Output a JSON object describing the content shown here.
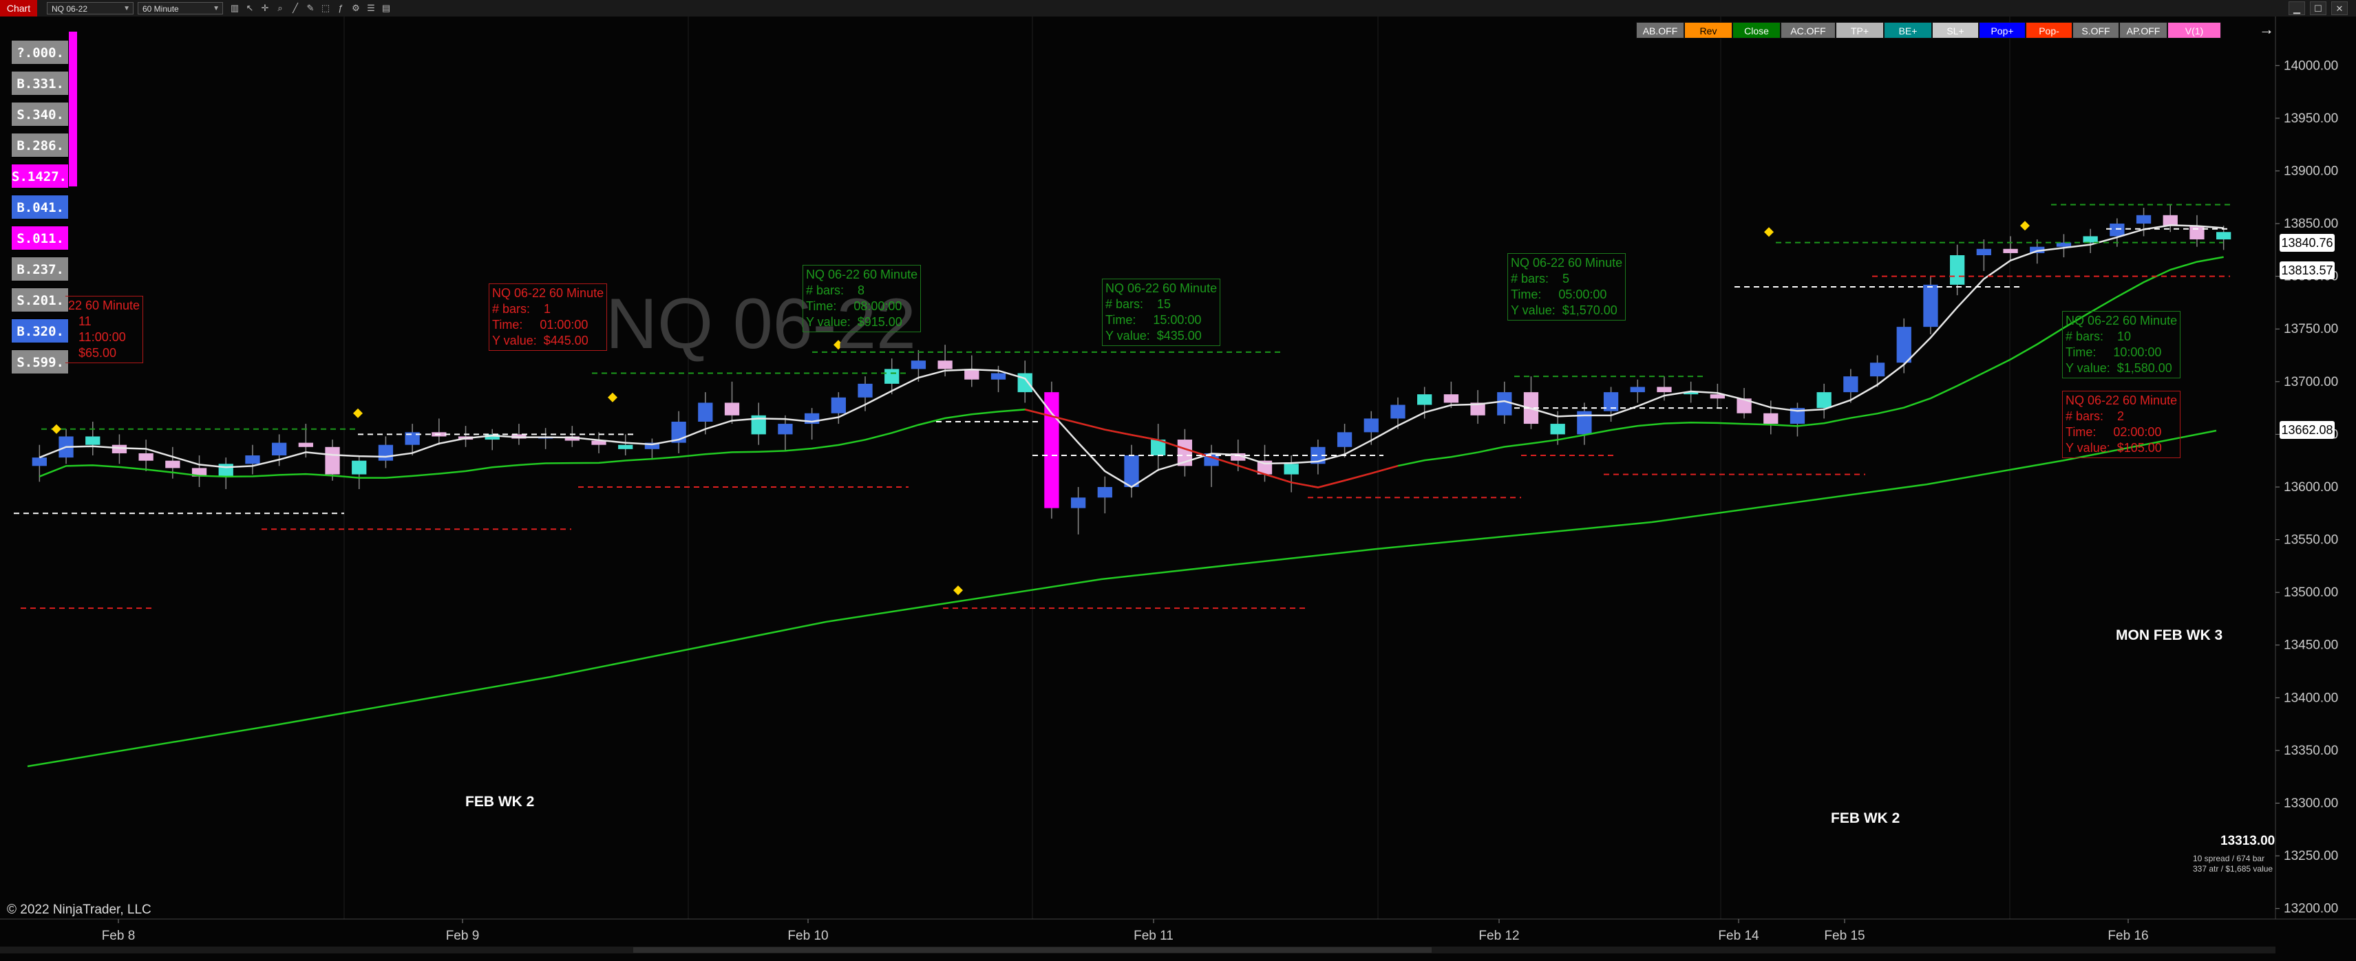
{
  "toolbar": {
    "chart_tab": "Chart",
    "instrument": "NQ 06-22",
    "interval": "60 Minute",
    "icons": [
      "bars-icon",
      "cursor-icon",
      "crosshair-icon",
      "zoom-icon",
      "line-tool-icon",
      "draw-tool-icon",
      "select-icon",
      "indicators-icon",
      "strategy-icon",
      "properties-icon",
      "data-box-icon"
    ],
    "window_buttons": [
      "minimize-icon",
      "maximize-icon",
      "close-icon"
    ]
  },
  "strategy_buttons": [
    {
      "label": "AB.OFF",
      "bg": "#6e6e6e",
      "fg": "#ffffff"
    },
    {
      "label": "Rev",
      "bg": "#ff8c00",
      "fg": "#000000"
    },
    {
      "label": "Close",
      "bg": "#007a00",
      "fg": "#ffffff"
    },
    {
      "label": "AC.OFF",
      "bg": "#6e6e6e",
      "fg": "#ffffff"
    },
    {
      "label": "TP+",
      "bg": "#b4b4b4",
      "fg": "#ffffff"
    },
    {
      "label": "BE+",
      "bg": "#008b8b",
      "fg": "#ffffff"
    },
    {
      "label": "SL+",
      "bg": "#c8c8c8",
      "fg": "#ffffff"
    },
    {
      "label": "Pop+",
      "bg": "#0000ff",
      "fg": "#ffffff"
    },
    {
      "label": "Pop-",
      "bg": "#ff3300",
      "fg": "#ffffff"
    },
    {
      "label": "S.OFF",
      "bg": "#6e6e6e",
      "fg": "#ffffff"
    },
    {
      "label": "AP.OFF",
      "bg": "#6e6e6e",
      "fg": "#ffffff"
    },
    {
      "label": "V(1)",
      "bg": "#ff66cc",
      "fg": "#ffffff"
    }
  ],
  "arrow_icon": "→",
  "side_buttons": [
    {
      "label": "?.000.",
      "bg": "#8a8a8a"
    },
    {
      "label": "B.331.",
      "bg": "#8a8a8a"
    },
    {
      "label": "S.340.",
      "bg": "#8a8a8a"
    },
    {
      "label": "B.286.",
      "bg": "#8a8a8a"
    },
    {
      "label": "S.1427.",
      "bg": "#ff00ff"
    },
    {
      "label": "B.041.",
      "bg": "#3a6ae0"
    },
    {
      "label": "S.011.",
      "bg": "#ff00ff"
    },
    {
      "label": "B.237.",
      "bg": "#8a8a8a"
    },
    {
      "label": "S.201.",
      "bg": "#8a8a8a"
    },
    {
      "label": "B.320.",
      "bg": "#3a6ae0"
    },
    {
      "label": "S.599.",
      "bg": "#8a8a8a"
    }
  ],
  "watermark": "NQ 06-22",
  "annotations": [
    {
      "color": "red",
      "lines": [
        "22 60 Minute",
        "   11",
        "   11:00:00",
        "   $65.00"
      ]
    },
    {
      "color": "red",
      "lines": [
        "NQ 06-22 60 Minute",
        "# bars:    1",
        "Time:     01:00:00",
        "Y value:  $445.00"
      ]
    },
    {
      "color": "green",
      "lines": [
        "NQ 06-22 60 Minute",
        "# bars:    8",
        "Time:     08:00:00",
        "Y value:  $915.00"
      ]
    },
    {
      "color": "green",
      "lines": [
        "NQ 06-22 60 Minute",
        "# bars:    15",
        "Time:     15:00:00",
        "Y value:  $435.00"
      ]
    },
    {
      "color": "green",
      "lines": [
        "NQ 06-22 60 Minute",
        "# bars:    5",
        "Time:     05:00:00",
        "Y value:  $1,570.00"
      ]
    },
    {
      "color": "green",
      "lines": [
        "NQ 06-22 60 Minute",
        "# bars:    10",
        "Time:     10:00:00",
        "Y value:  $1,580.00"
      ]
    },
    {
      "color": "red",
      "lines": [
        "NQ 06-22 60 Minute",
        "# bars:    2",
        "Time:     02:00:00",
        "Y value:  $105.00"
      ]
    }
  ],
  "week_labels": [
    "FEB WK 2",
    "FEB WK 2",
    "MON FEB WK 3"
  ],
  "price_labels": [
    {
      "value": "13840.76",
      "bg": "#ffffff"
    },
    {
      "value": "13813.57",
      "bg": "#ffffff"
    },
    {
      "value": "13662.08",
      "bg": "#ffffff"
    }
  ],
  "stats": {
    "price": "13313.00",
    "line1": "10 spread / 674 bar",
    "line2": "337 atr / $1,685 value"
  },
  "copyright": "© 2022 NinjaTrader, LLC",
  "chart_data": {
    "type": "candlestick",
    "instrument": "NQ 06-22",
    "interval": "60 Minute",
    "ylim": [
      13190,
      14040
    ],
    "y_ticks": [
      "14000.00",
      "13950.00",
      "13900.00",
      "13850.00",
      "13800.00",
      "13750.00",
      "13700.00",
      "13650.00",
      "13600.00",
      "13550.00",
      "13500.00",
      "13450.00",
      "13400.00",
      "13350.00",
      "13300.00",
      "13250.00",
      "13200.00"
    ],
    "x_ticks": [
      "Feb 8",
      "Feb 9",
      "Feb 10",
      "Feb 11",
      "Feb 12",
      "Feb 14",
      "Feb 15",
      "Feb 16"
    ],
    "candles": [
      [
        13620,
        13640,
        13605,
        13628
      ],
      [
        13628,
        13655,
        13622,
        13648
      ],
      [
        13648,
        13662,
        13630,
        13640
      ],
      [
        13640,
        13650,
        13622,
        13632
      ],
      [
        13632,
        13645,
        13615,
        13625
      ],
      [
        13625,
        13638,
        13608,
        13618
      ],
      [
        13618,
        13630,
        13600,
        13610
      ],
      [
        13610,
        13628,
        13598,
        13622
      ],
      [
        13622,
        13640,
        13612,
        13630
      ],
      [
        13630,
        13650,
        13620,
        13642
      ],
      [
        13642,
        13660,
        13628,
        13638
      ],
      [
        13638,
        13645,
        13606,
        13612
      ],
      [
        13612,
        13630,
        13598,
        13625
      ],
      [
        13625,
        13648,
        13618,
        13640
      ],
      [
        13640,
        13660,
        13630,
        13652
      ],
      [
        13652,
        13665,
        13640,
        13648
      ],
      [
        13648,
        13658,
        13638,
        13645
      ],
      [
        13645,
        13655,
        13635,
        13650
      ],
      [
        13650,
        13660,
        13640,
        13646
      ],
      [
        13646,
        13656,
        13636,
        13648
      ],
      [
        13648,
        13658,
        13638,
        13644
      ],
      [
        13644,
        13652,
        13632,
        13640
      ],
      [
        13640,
        13650,
        13630,
        13636
      ],
      [
        13636,
        13646,
        13626,
        13642
      ],
      [
        13642,
        13672,
        13632,
        13662
      ],
      [
        13662,
        13690,
        13650,
        13680
      ],
      [
        13680,
        13700,
        13660,
        13668
      ],
      [
        13668,
        13680,
        13640,
        13650
      ],
      [
        13650,
        13668,
        13635,
        13660
      ],
      [
        13660,
        13675,
        13645,
        13670
      ],
      [
        13670,
        13690,
        13660,
        13685
      ],
      [
        13685,
        13705,
        13672,
        13698
      ],
      [
        13698,
        13722,
        13688,
        13712
      ],
      [
        13712,
        13730,
        13700,
        13720
      ],
      [
        13720,
        13735,
        13705,
        13712
      ],
      [
        13712,
        13725,
        13695,
        13702
      ],
      [
        13702,
        13715,
        13690,
        13708
      ],
      [
        13708,
        13720,
        13680,
        13690
      ],
      [
        13690,
        13700,
        13570,
        13580
      ],
      [
        13580,
        13600,
        13555,
        13590
      ],
      [
        13590,
        13610,
        13575,
        13600
      ],
      [
        13600,
        13640,
        13590,
        13630
      ],
      [
        13630,
        13660,
        13615,
        13645
      ],
      [
        13645,
        13655,
        13610,
        13620
      ],
      [
        13620,
        13640,
        13600,
        13632
      ],
      [
        13632,
        13645,
        13615,
        13625
      ],
      [
        13625,
        13640,
        13605,
        13612
      ],
      [
        13612,
        13630,
        13595,
        13622
      ],
      [
        13622,
        13645,
        13612,
        13638
      ],
      [
        13638,
        13660,
        13628,
        13652
      ],
      [
        13652,
        13672,
        13640,
        13665
      ],
      [
        13665,
        13685,
        13655,
        13678
      ],
      [
        13678,
        13695,
        13665,
        13688
      ],
      [
        13688,
        13700,
        13675,
        13680
      ],
      [
        13680,
        13692,
        13660,
        13668
      ],
      [
        13668,
        13700,
        13660,
        13690
      ],
      [
        13690,
        13705,
        13655,
        13660
      ],
      [
        13660,
        13672,
        13640,
        13650
      ],
      [
        13650,
        13680,
        13640,
        13672
      ],
      [
        13672,
        13695,
        13662,
        13690
      ],
      [
        13690,
        13702,
        13680,
        13695
      ],
      [
        13695,
        13705,
        13682,
        13690
      ],
      [
        13690,
        13700,
        13680,
        13688
      ],
      [
        13688,
        13698,
        13675,
        13684
      ],
      [
        13684,
        13694,
        13665,
        13670
      ],
      [
        13670,
        13682,
        13650,
        13660
      ],
      [
        13660,
        13680,
        13648,
        13675
      ],
      [
        13675,
        13698,
        13665,
        13690
      ],
      [
        13690,
        13712,
        13680,
        13705
      ],
      [
        13705,
        13725,
        13695,
        13718
      ],
      [
        13718,
        13760,
        13708,
        13752
      ],
      [
        13752,
        13800,
        13745,
        13792
      ],
      [
        13792,
        13830,
        13782,
        13820
      ],
      [
        13820,
        13835,
        13805,
        13826
      ],
      [
        13826,
        13838,
        13815,
        13822
      ],
      [
        13822,
        13835,
        13812,
        13828
      ],
      [
        13828,
        13840,
        13818,
        13832
      ],
      [
        13832,
        13845,
        13822,
        13838
      ],
      [
        13838,
        13855,
        13828,
        13850
      ],
      [
        13850,
        13865,
        13838,
        13858
      ],
      [
        13858,
        13868,
        13842,
        13848
      ],
      [
        13848,
        13858,
        13828,
        13835
      ],
      [
        13835,
        13848,
        13825,
        13842
      ]
    ],
    "overlays": [
      {
        "name": "fast-ma",
        "color": "#e8e8e8"
      },
      {
        "name": "mid-ma",
        "color": "#22cc22"
      },
      {
        "name": "slow-ma",
        "color": "#22cc22"
      }
    ]
  }
}
